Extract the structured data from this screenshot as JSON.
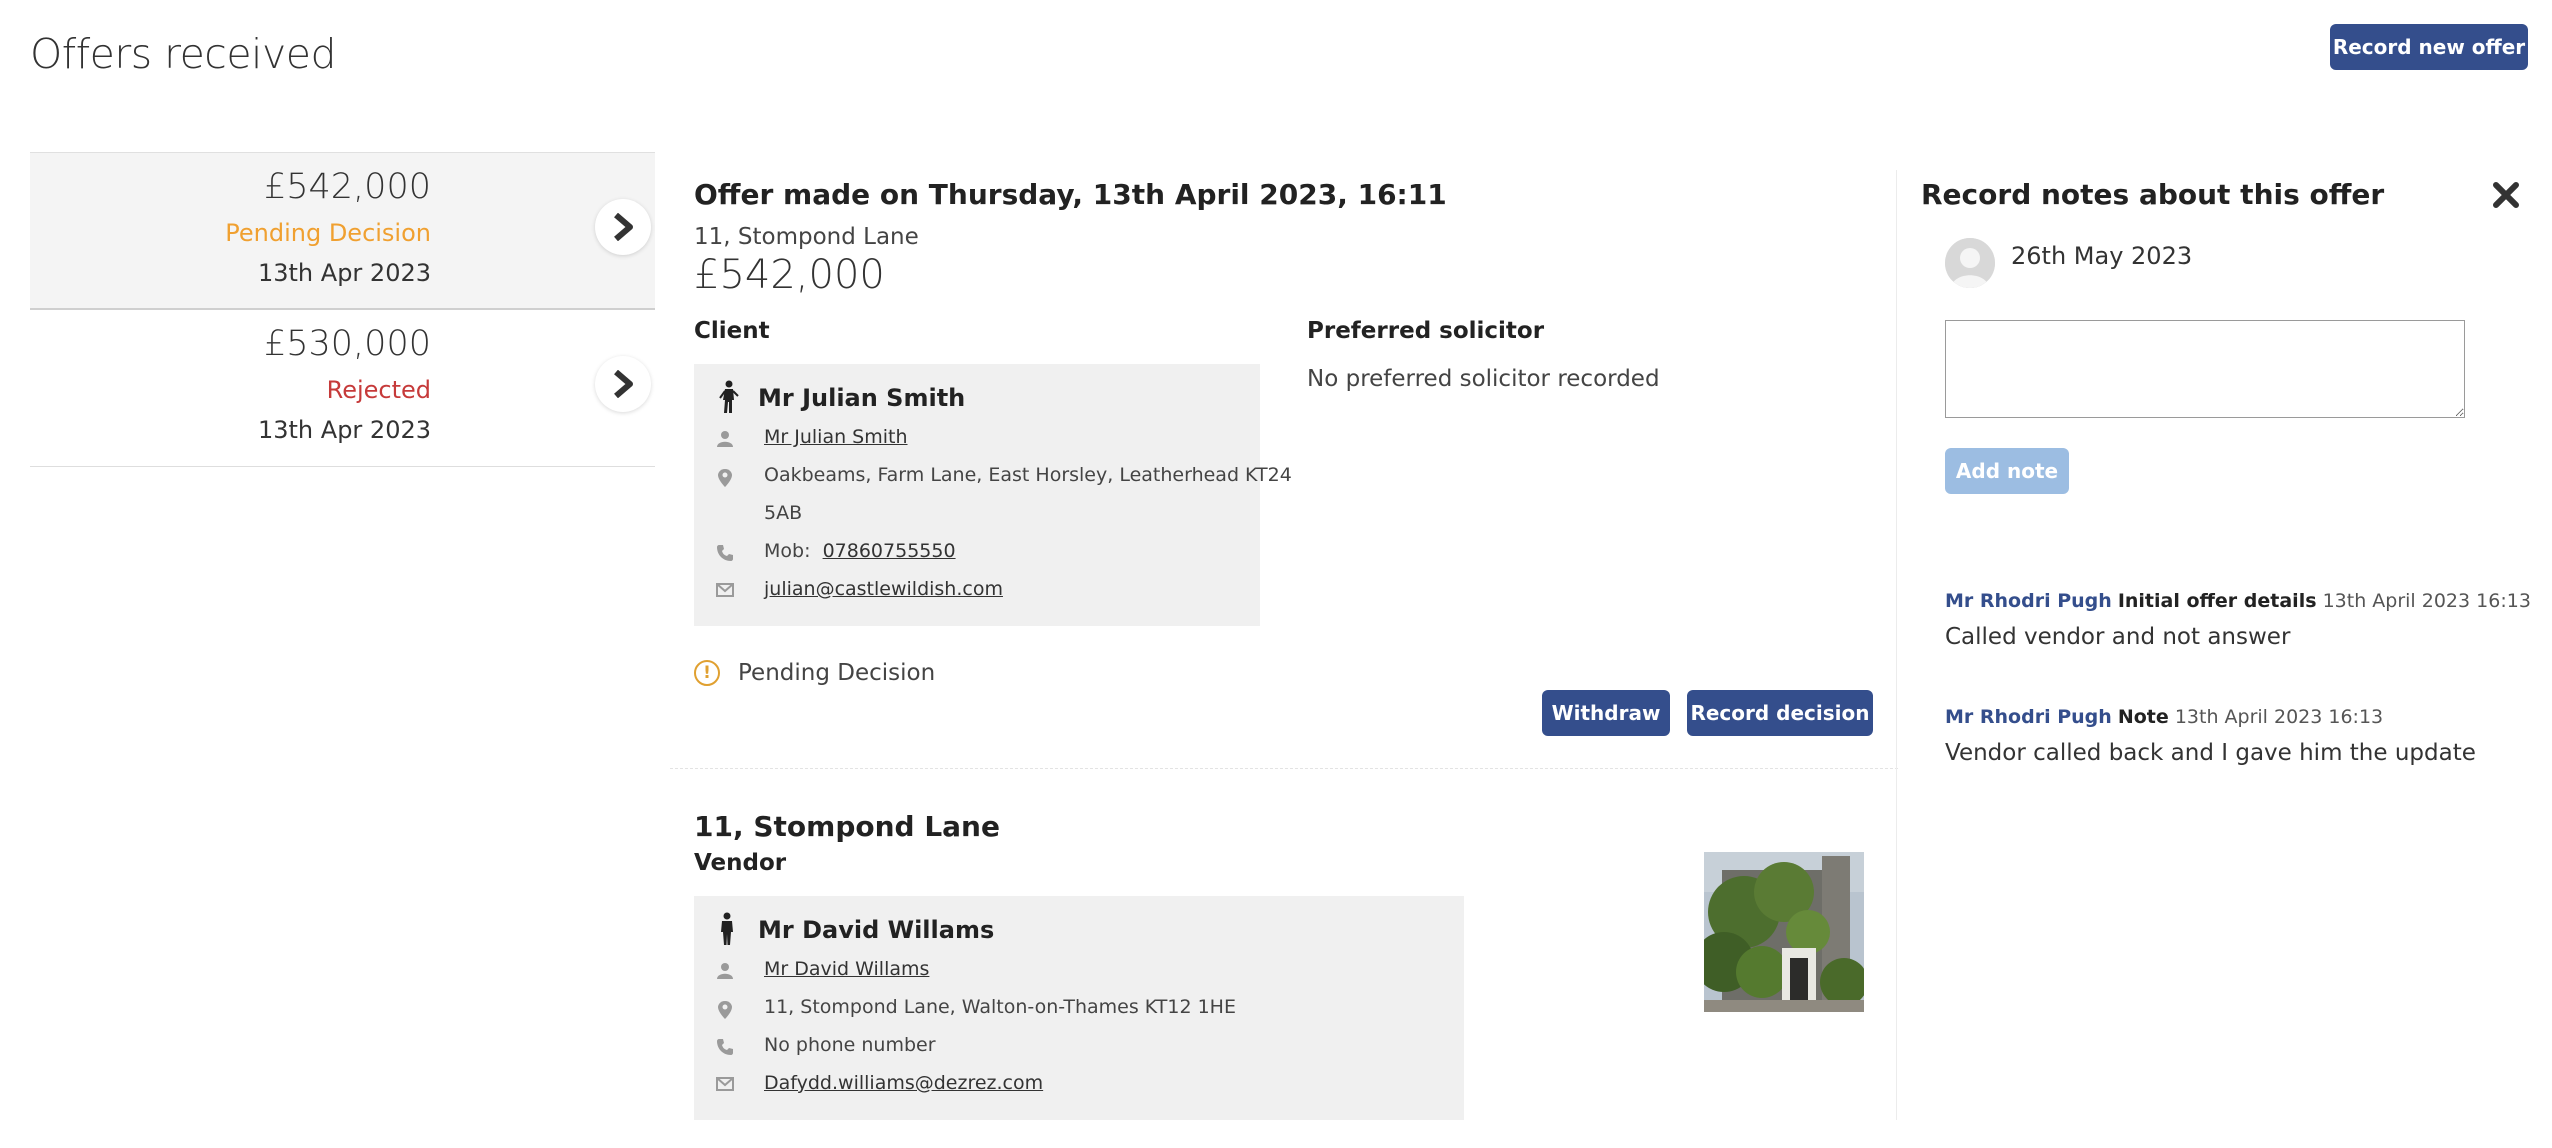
{
  "page": {
    "title": "Offers received",
    "record_new_offer_label": "Record new offer"
  },
  "offers": [
    {
      "amount": "£542,000",
      "status": "Pending Decision",
      "status_color": "#f0a030",
      "date": "13th Apr 2023"
    },
    {
      "amount": "£530,000",
      "status": "Rejected",
      "status_color": "#c63a3a",
      "date": "13th Apr 2023"
    }
  ],
  "detail": {
    "heading": "Offer made on Thursday, 13th April 2023, 16:11",
    "address": "11, Stompond Lane",
    "amount": "£542,000",
    "client_label": "Client",
    "solicitor_label": "Preferred solicitor",
    "solicitor_value": "No preferred solicitor recorded",
    "client": {
      "name": "Mr Julian Smith",
      "link_name": "Mr Julian Smith",
      "address": "Oakbeams, Farm Lane, East Horsley, Leatherhead KT24",
      "address_cont": "5AB",
      "phone_prefix": "Mob:",
      "phone": "07860755550",
      "email": "julian@castlewildish.com"
    },
    "status_text": "Pending Decision",
    "withdraw_label": "Withdraw",
    "record_decision_label": "Record decision",
    "property_title": "11, Stompond Lane",
    "vendor_label": "Vendor",
    "vendor": {
      "name": "Mr David Willams",
      "link_name": "Mr David Willams",
      "address": "11, Stompond Lane, Walton-on-Thames KT12 1HE",
      "phone": "No phone number",
      "email": "Dafydd.williams@dezrez.com"
    }
  },
  "notes": {
    "title": "Record notes about this offer",
    "date": "26th May 2023",
    "add_note_label": "Add note",
    "entries": [
      {
        "author": "Mr Rhodri Pugh",
        "type": "Initial offer details",
        "time": "13th April 2023 16:13",
        "body": "Called vendor and not answer"
      },
      {
        "author": "Mr Rhodri Pugh",
        "type": "Note",
        "time": "13th April 2023 16:13",
        "body": "Vendor called back and I gave him the update"
      }
    ]
  },
  "colors": {
    "primary": "#344e8c",
    "pending": "#f0a030",
    "rejected": "#c63a3a",
    "disabled_button": "#9cbde2"
  }
}
